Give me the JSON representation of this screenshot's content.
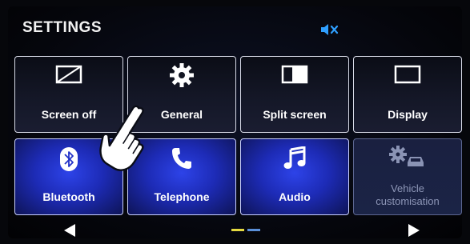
{
  "header": {
    "title": "SETTINGS",
    "mute_icon": "speaker-muted-icon"
  },
  "tiles": [
    {
      "label": "Screen off",
      "icon": "screen-off-icon",
      "state": "normal"
    },
    {
      "label": "General",
      "icon": "gear-icon",
      "state": "normal"
    },
    {
      "label": "Split screen",
      "icon": "split-screen-icon",
      "state": "normal"
    },
    {
      "label": "Display",
      "icon": "display-icon",
      "state": "normal"
    },
    {
      "label": "Bluetooth",
      "icon": "bluetooth-icon",
      "state": "highlighted"
    },
    {
      "label": "Telephone",
      "icon": "phone-icon",
      "state": "highlighted"
    },
    {
      "label": "Audio",
      "icon": "music-note-icon",
      "state": "highlighted"
    },
    {
      "label_line1": "Vehicle",
      "label_line2": "customisation",
      "icon": "gear-car-icon",
      "state": "disabled"
    }
  ],
  "pager": {
    "prev_icon": "arrow-left-icon",
    "next_icon": "arrow-right-icon",
    "page_indicator": {
      "current": 1,
      "total": 2
    }
  },
  "overlay": {
    "pointer_icon": "pointing-hand-icon"
  },
  "colors": {
    "accent_blue": "#1d2bb6",
    "tile_border": "#d6d9e6",
    "page_dot_active": "#e4d941",
    "page_dot_inactive": "#5a8fd8"
  }
}
